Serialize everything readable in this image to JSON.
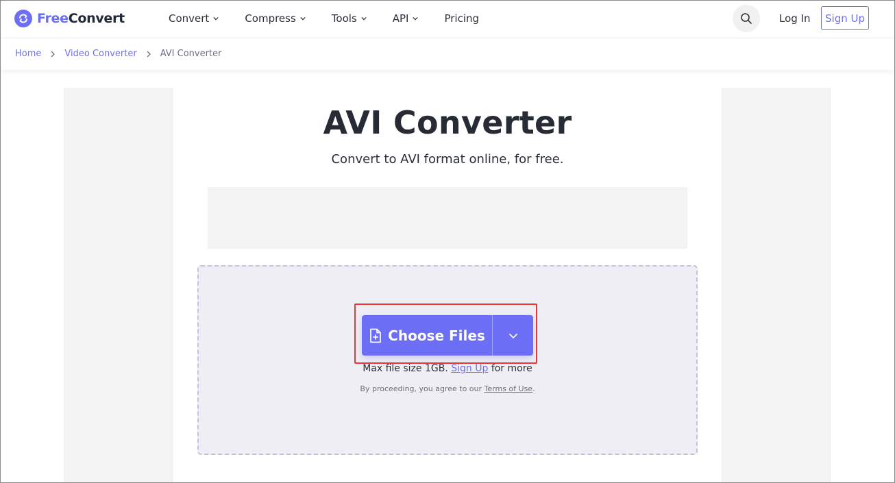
{
  "brand": {
    "part1": "Free",
    "part2": "Convert"
  },
  "nav": [
    {
      "label": "Convert"
    },
    {
      "label": "Compress"
    },
    {
      "label": "Tools"
    },
    {
      "label": "API"
    },
    {
      "label": "Pricing"
    }
  ],
  "header": {
    "login": "Log In",
    "signup": "Sign Up"
  },
  "breadcrumb": {
    "home": "Home",
    "video_converter": "Video Converter",
    "current": "AVI Converter"
  },
  "page": {
    "title": "AVI Converter",
    "subtitle": "Convert to AVI format online, for free."
  },
  "upload": {
    "choose_label": "Choose Files",
    "max_prefix": "Max file size 1GB.",
    "max_link": "Sign Up",
    "max_suffix": "for more",
    "terms_prefix": "By proceeding, you agree to our",
    "terms_link": "Terms of Use",
    "terms_suffix": "."
  },
  "colors": {
    "accent": "#6c6ff5",
    "text": "#262b35",
    "dropzone_bg": "#efeef4",
    "highlight": "#e53935"
  }
}
